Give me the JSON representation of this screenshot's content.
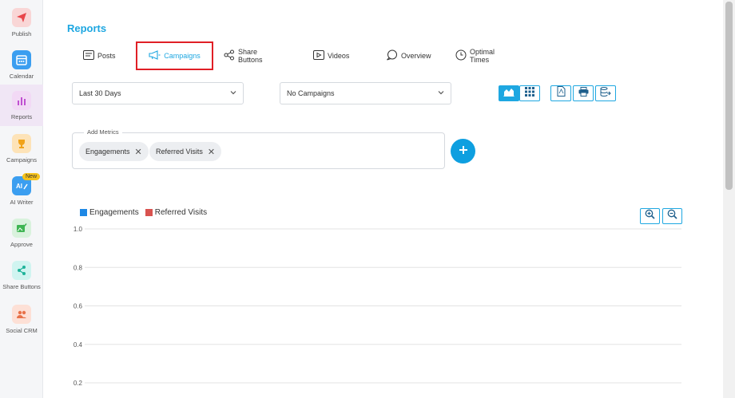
{
  "sidebar": {
    "items": [
      {
        "label": "Publish",
        "icon": "send-icon",
        "color": "#f9d6d6",
        "fg": "#e8464a"
      },
      {
        "label": "Calendar",
        "icon": "calendar-icon",
        "color": "#3b9ef0",
        "fg": "#ffffff"
      },
      {
        "label": "Reports",
        "icon": "bar-chart-icon",
        "color": "#f2d9f5",
        "fg": "#c04fd1"
      },
      {
        "label": "Campaigns",
        "icon": "trophy-icon",
        "color": "#fde3b8",
        "fg": "#f1a31a"
      },
      {
        "label": "AI Writer",
        "icon": "ai-pen-icon",
        "color": "#3b9ef0",
        "fg": "#ffffff",
        "badge": "New"
      },
      {
        "label": "Approve",
        "icon": "image-check-icon",
        "color": "#d9f2dd",
        "fg": "#3fb553"
      },
      {
        "label": "Share Buttons",
        "icon": "share-icon",
        "color": "#d0f4f0",
        "fg": "#1fb39a"
      },
      {
        "label": "Social CRM",
        "icon": "people-icon",
        "color": "#fde0d6",
        "fg": "#e8724a"
      }
    ]
  },
  "page": {
    "title": "Reports"
  },
  "tabs": [
    {
      "label": "Posts",
      "icon": "posts-icon"
    },
    {
      "label": "Campaigns",
      "icon": "megaphone-icon",
      "active": true
    },
    {
      "label": "Share Buttons",
      "icon": "share-icon"
    },
    {
      "label": "Videos",
      "icon": "video-icon"
    },
    {
      "label": "Overview",
      "icon": "chat-bubble-icon"
    },
    {
      "label": "Optimal Times",
      "icon": "clock-icon"
    }
  ],
  "filters": {
    "date_range": "Last 30 Days",
    "campaign": "No Campaigns"
  },
  "metrics": {
    "legend": "Add Metrics",
    "chips": [
      "Engagements",
      "Referred Visits"
    ],
    "remove_symbol": "✕",
    "add_symbol": "+"
  },
  "colors": {
    "accent": "#1ea7e1",
    "highlight": "#e01f26"
  },
  "chart_data": {
    "type": "line",
    "series": [
      {
        "name": "Engagements",
        "color": "#1e88e5",
        "values": []
      },
      {
        "name": "Referred Visits",
        "color": "#d9534f",
        "values": []
      }
    ],
    "yticks": [
      "1.0",
      "0.8",
      "0.6",
      "0.4",
      "0.2"
    ],
    "ylim": [
      0,
      1.0
    ],
    "grid": true,
    "legend": "top-left"
  }
}
